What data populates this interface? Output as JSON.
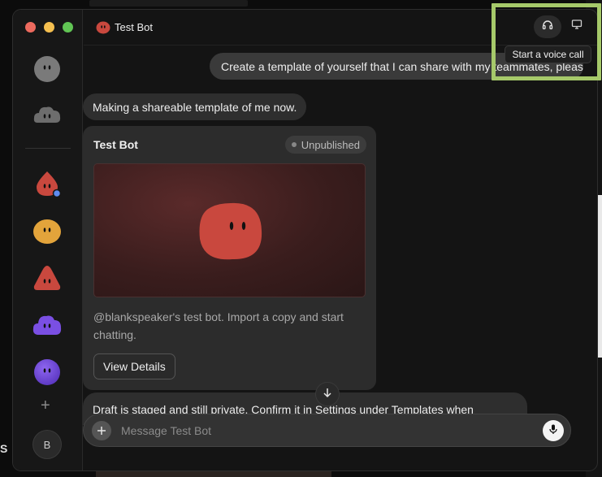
{
  "window": {
    "title": "Test Bot"
  },
  "header": {
    "title": "Test Bot",
    "tooltip": "Start a voice call",
    "voice_icon": "headset-icon",
    "screen_icon": "monitor-icon"
  },
  "sidebar": {
    "bots": [
      {
        "name": "gray-blob",
        "color": "#7a7a7a"
      },
      {
        "name": "gray-cloud",
        "color": "#6d6d6d"
      },
      {
        "name": "red-drop",
        "color": "#c9483e",
        "status": "#5e8cf0"
      },
      {
        "name": "yellow-blob",
        "color": "#e3a43b"
      },
      {
        "name": "red-triangle",
        "color": "#c9483e"
      },
      {
        "name": "purple-cloud",
        "color": "#7a4fe3"
      },
      {
        "name": "purple-ball",
        "color": "#7a4fe3"
      }
    ],
    "add_label": "+",
    "user_initial": "B"
  },
  "messages": {
    "user_1": "Create a template of yourself that I can share with my teammates, please.",
    "bot_1": "Making a shareable template of me now.",
    "bot_2": "Draft is staged and still private. Confirm it in Settings under Templates when"
  },
  "card": {
    "title": "Test Bot",
    "badge": "Unpublished",
    "description": "@blankspeaker's test bot. Import a copy and start chatting.",
    "button": "View Details"
  },
  "composer": {
    "placeholder": "Message Test Bot",
    "value": ""
  },
  "colors": {
    "accent": "#c9483e",
    "highlight": "#a6c96a"
  },
  "background": {
    "letter": "S"
  }
}
